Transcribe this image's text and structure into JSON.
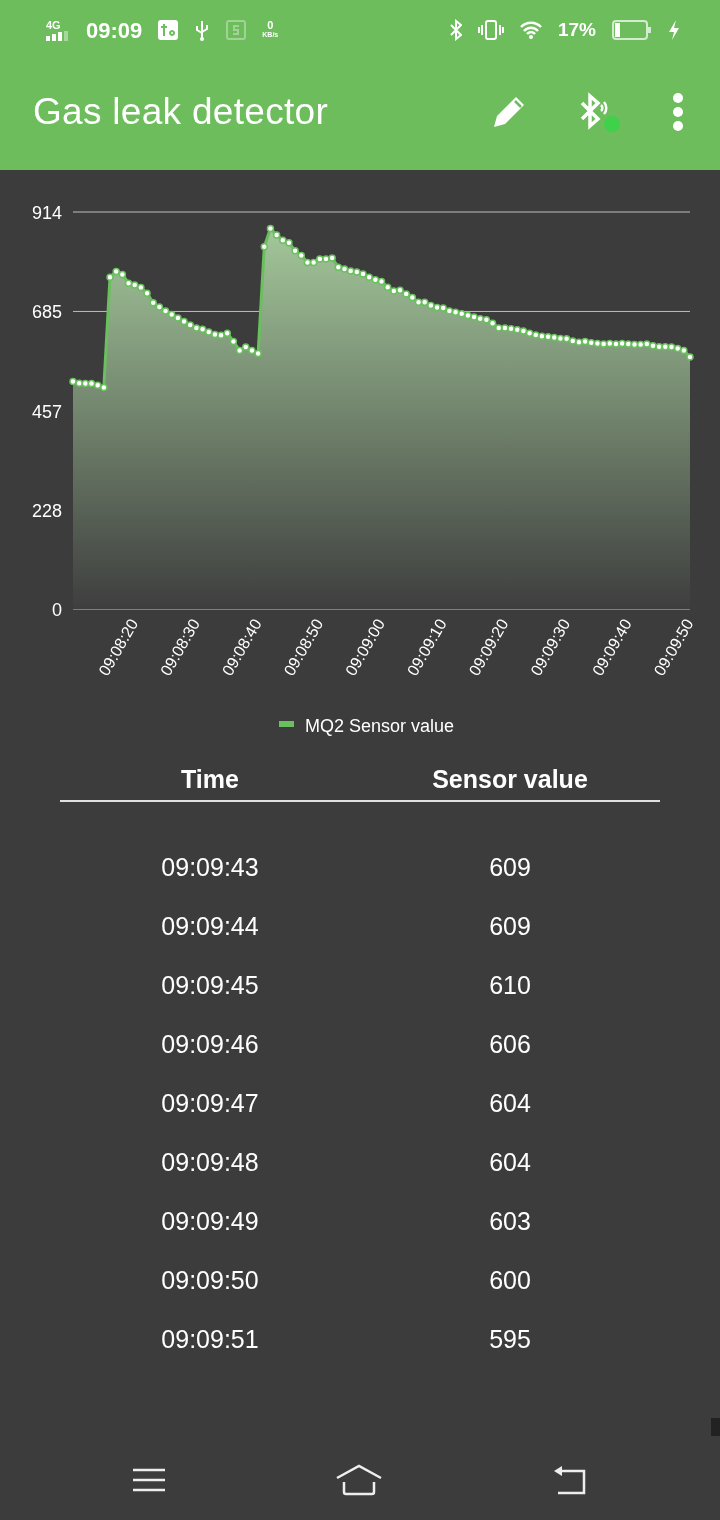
{
  "status_bar": {
    "network": "4G",
    "time": "09:09",
    "speed_value": "0",
    "speed_unit": "KB/s",
    "battery": "17%"
  },
  "app_bar": {
    "title": "Gas leak detector",
    "bluetooth_connected": true
  },
  "chart": {
    "chart_data": {
      "type": "area",
      "ylim": [
        0,
        914
      ],
      "categories": [
        null,
        null,
        null,
        null,
        null,
        null,
        null,
        null,
        null,
        null,
        "09:08:20",
        null,
        null,
        null,
        null,
        null,
        null,
        null,
        null,
        null,
        "09:08:30",
        null,
        null,
        null,
        null,
        null,
        null,
        null,
        null,
        null,
        "09:08:40",
        null,
        null,
        null,
        null,
        null,
        null,
        null,
        null,
        null,
        "09:08:50",
        null,
        null,
        null,
        null,
        null,
        null,
        null,
        null,
        null,
        "09:09:00",
        null,
        null,
        null,
        null,
        null,
        null,
        null,
        null,
        null,
        "09:09:10",
        null,
        null,
        null,
        null,
        null,
        null,
        null,
        null,
        null,
        "09:09:20",
        null,
        null,
        null,
        null,
        null,
        null,
        null,
        null,
        null,
        "09:09:30",
        null,
        null,
        null,
        null,
        null,
        null,
        null,
        null,
        null,
        "09:09:40",
        null,
        null,
        null,
        null,
        null,
        null,
        null,
        null,
        null,
        "09:09:50"
      ],
      "yticks": [
        0,
        228,
        457,
        685,
        914
      ],
      "series": [
        {
          "name": "MQ2 Sensor value",
          "color": "#6abf5e",
          "values": [
            524,
            520,
            519,
            519,
            515,
            510,
            764,
            777,
            770,
            750,
            746,
            740,
            727,
            705,
            695,
            686,
            678,
            670,
            662,
            654,
            647,
            644,
            638,
            632,
            630,
            635,
            616,
            595,
            603,
            595,
            588,
            834,
            876,
            861,
            849,
            843,
            825,
            814,
            798,
            798,
            806,
            806,
            808,
            787,
            783,
            778,
            776,
            771,
            764,
            758,
            754,
            741,
            732,
            734,
            725,
            717,
            706,
            706,
            699,
            694,
            693,
            686,
            683,
            680,
            676,
            672,
            668,
            666,
            658,
            647,
            647,
            645,
            643,
            640,
            635,
            631,
            628,
            627,
            625,
            623,
            622,
            617,
            614,
            616,
            613,
            611,
            610,
            611,
            610,
            611,
            610,
            609,
            609,
            610,
            606,
            604,
            604,
            603,
            600,
            595,
            580
          ]
        }
      ]
    }
  },
  "table": {
    "columns": [
      "Time",
      "Sensor value"
    ],
    "rows": [
      [
        "09:09:43",
        "609"
      ],
      [
        "09:09:44",
        "609"
      ],
      [
        "09:09:45",
        "610"
      ],
      [
        "09:09:46",
        "606"
      ],
      [
        "09:09:47",
        "604"
      ],
      [
        "09:09:48",
        "604"
      ],
      [
        "09:09:49",
        "603"
      ],
      [
        "09:09:50",
        "600"
      ],
      [
        "09:09:51",
        "595"
      ]
    ]
  }
}
